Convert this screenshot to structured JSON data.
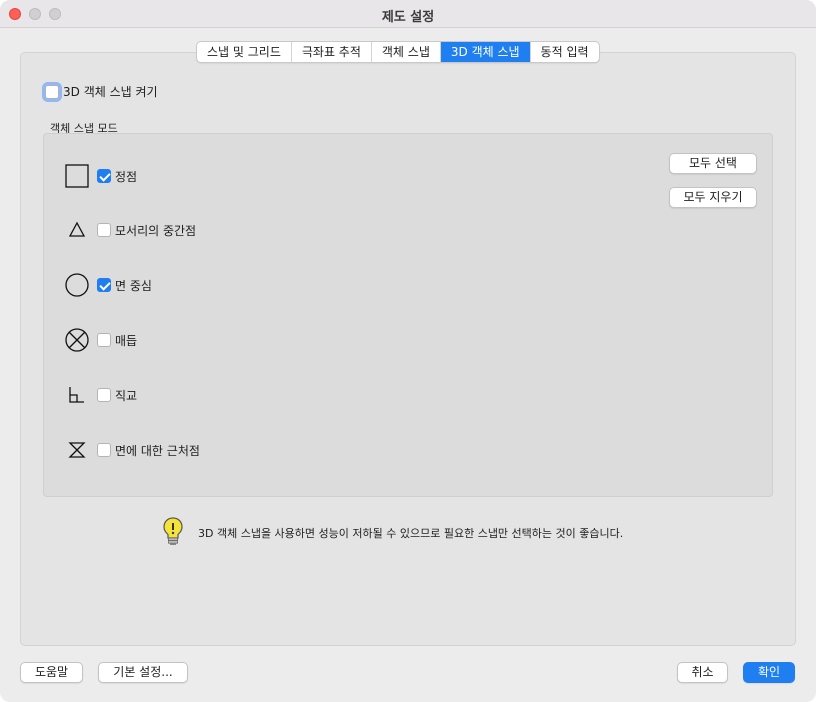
{
  "window": {
    "title": "제도 설정"
  },
  "tabs": [
    {
      "label": "스냅 및 그리드",
      "active": false
    },
    {
      "label": "극좌표 추적",
      "active": false
    },
    {
      "label": "객체 스냅",
      "active": false
    },
    {
      "label": "3D 객체 스냅",
      "active": true
    },
    {
      "label": "동적 입력",
      "active": false
    }
  ],
  "enable": {
    "label": "3D 객체 스냅 켜기",
    "checked": false
  },
  "modes_group": {
    "label": "객체 스냅 모드",
    "items": [
      {
        "label": "정점",
        "icon": "square-icon",
        "checked": true
      },
      {
        "label": "모서리의 중간점",
        "icon": "triangle-icon",
        "checked": false
      },
      {
        "label": "면 중심",
        "icon": "circle-icon",
        "checked": true
      },
      {
        "label": "매듭",
        "icon": "circle-x-icon",
        "checked": false
      },
      {
        "label": "직교",
        "icon": "perpendicular-icon",
        "checked": false
      },
      {
        "label": "면에 대한 근처점",
        "icon": "hourglass-icon",
        "checked": false
      }
    ],
    "select_all_label": "모두 선택",
    "clear_all_label": "모두 지우기"
  },
  "tip": {
    "icon": "lightbulb-icon",
    "text": "3D 객체 스냅을 사용하면 성능이 저하될 수 있으므로 필요한 스냅만 선택하는 것이 좋습니다."
  },
  "footer": {
    "help_label": "도움말",
    "defaults_label": "기본 설정...",
    "cancel_label": "취소",
    "ok_label": "확인"
  },
  "colors": {
    "accent": "#1f7ff0",
    "close": "#ff5f57"
  }
}
